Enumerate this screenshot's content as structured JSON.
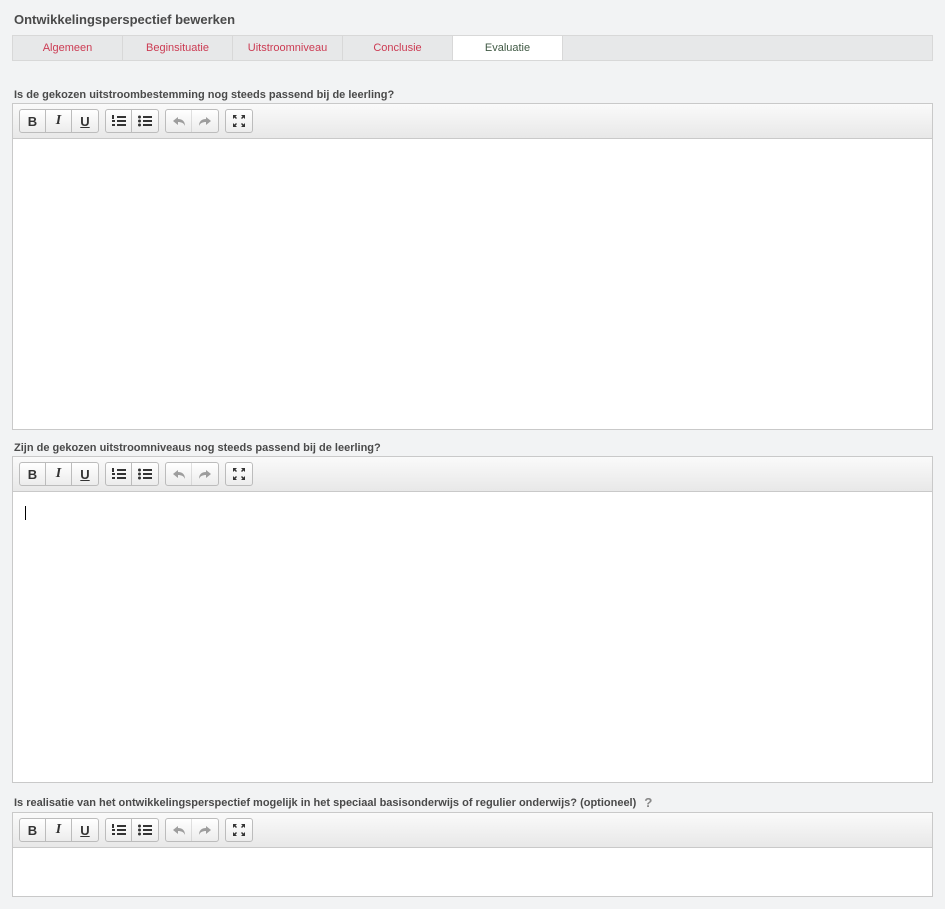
{
  "page": {
    "title": "Ontwikkelingsperspectief bewerken"
  },
  "tabs": {
    "algemeen": {
      "label": "Algemeen"
    },
    "beginsituatie": {
      "label": "Beginsituatie"
    },
    "uitstroomniveau": {
      "label": "Uitstroomniveau"
    },
    "conclusie": {
      "label": "Conclusie"
    },
    "evaluatie": {
      "label": "Evaluatie"
    }
  },
  "tabs_active": "evaluatie",
  "sections": {
    "q1": {
      "label": "Is de gekozen uitstroombestemming nog steeds passend bij de leerling?",
      "value": ""
    },
    "q2": {
      "label": "Zijn de gekozen uitstroomniveaus nog steeds passend bij de leerling?",
      "value": ""
    },
    "q3": {
      "label": "Is realisatie van het ontwikkelingsperspectief mogelijk in het speciaal basisonderwijs of regulier onderwijs? (optioneel)",
      "help": "?",
      "value": ""
    }
  },
  "toolbar": {
    "bold": "B",
    "italic": "I",
    "underline": "U"
  }
}
